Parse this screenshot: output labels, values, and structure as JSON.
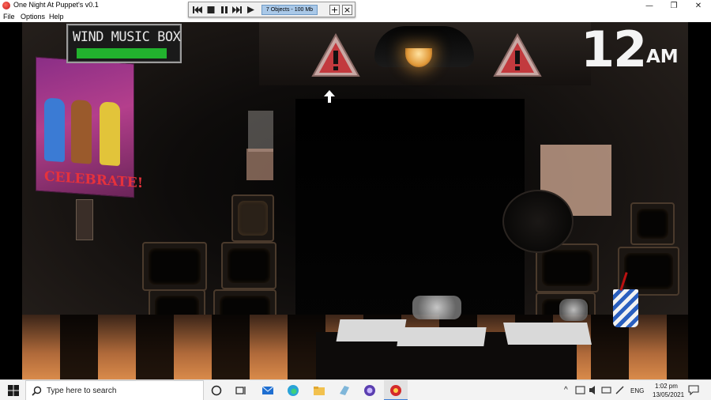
{
  "window": {
    "title": "One Night At Puppet's v0.1",
    "minimize": "—",
    "restore": "❐",
    "close": "✕"
  },
  "menu": [
    "File",
    "Options",
    "Help"
  ],
  "media_toolbar": {
    "status": "7 Objects - 100 Mb",
    "plus": "+",
    "close": "×"
  },
  "hud": {
    "wind_label": "WIND MUSIC BOX",
    "wind_level": 1.0,
    "wind_color": "#22b22e",
    "clock_hour": "12",
    "clock_ampm": "AM"
  },
  "scene": {
    "poster_text": "CELEBRATE!"
  },
  "taskbar": {
    "search_placeholder": "Type here to search",
    "language": "ENG",
    "time": "1:02 pm",
    "date": "13/05/2021"
  }
}
